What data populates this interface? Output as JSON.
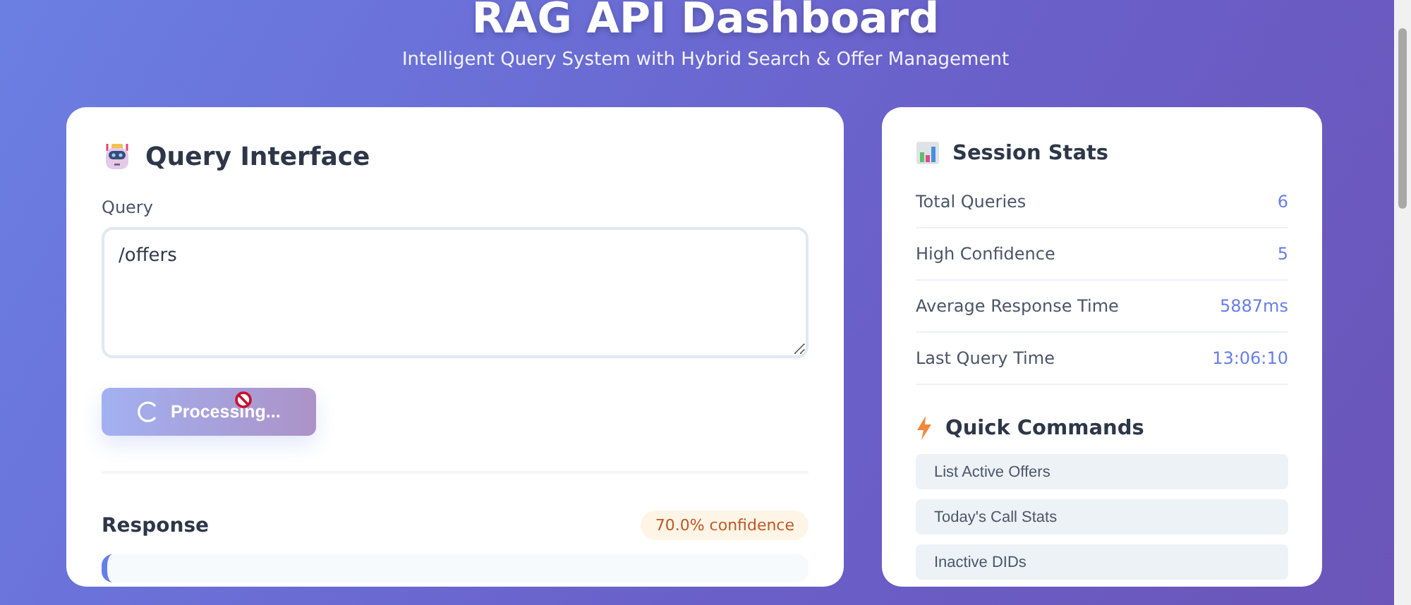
{
  "header": {
    "title": "RAG API Dashboard",
    "subtitle": "Intelligent Query System with Hybrid Search & Offer Management"
  },
  "query_panel": {
    "title": "Query Interface",
    "field_label": "Query",
    "query_value": "/offers",
    "submit_button": {
      "label": "Processing...",
      "disabled": true,
      "loading": true
    },
    "response_title": "Response",
    "confidence_badge": "70.0% confidence"
  },
  "session_stats": {
    "title": "Session Stats",
    "rows": [
      {
        "label": "Total Queries",
        "value": "6"
      },
      {
        "label": "High Confidence",
        "value": "5"
      },
      {
        "label": "Average Response Time",
        "value": "5887ms"
      },
      {
        "label": "Last Query Time",
        "value": "13:06:10"
      }
    ]
  },
  "quick_commands": {
    "title": "Quick Commands",
    "items": [
      "List Active Offers",
      "Today's Call Stats",
      "Inactive DIDs"
    ]
  }
}
